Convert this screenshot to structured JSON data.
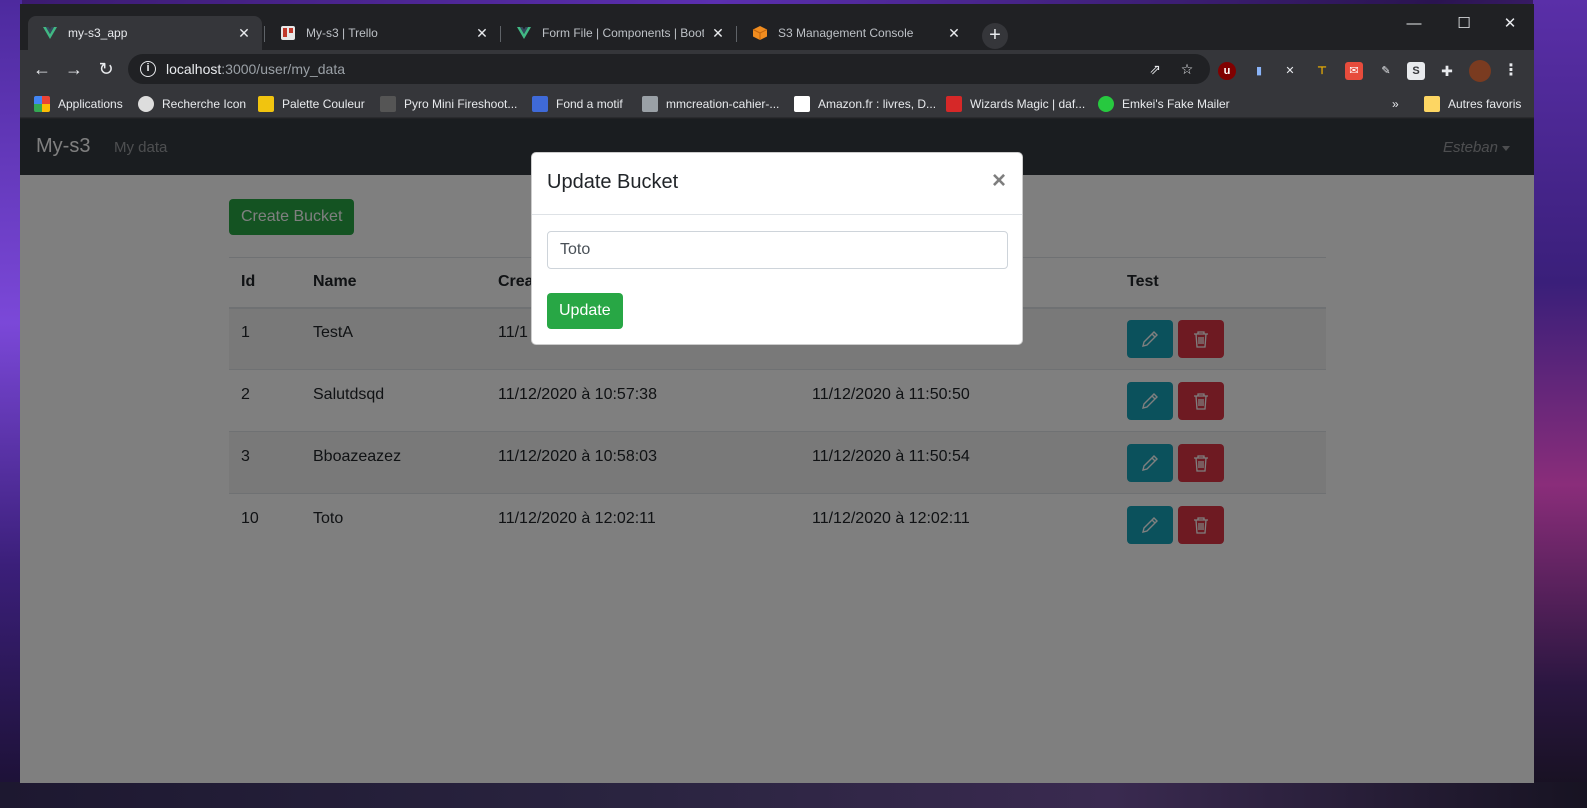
{
  "browser": {
    "tabs": [
      {
        "title": "my-s3_app",
        "icon_color": "#41b883",
        "active": true
      },
      {
        "title": "My-s3 | Trello",
        "icon_color": "#e8e8e8",
        "active": false
      },
      {
        "title": "Form File | Components | Bootstr",
        "icon_color": "#41b883",
        "active": false
      },
      {
        "title": "S3 Management Console",
        "icon_color": "#f08c1f",
        "active": false
      }
    ],
    "url_host": "localhost",
    "url_path": ":3000/user/my_data",
    "bookmarks": [
      {
        "label": "Applications",
        "color": "#ea4335"
      },
      {
        "label": "Recherche Icon",
        "color": "#dddddd"
      },
      {
        "label": "Palette Couleur",
        "color": "#f1c40f"
      },
      {
        "label": "Pyro Mini Fireshoot...",
        "color": "#555555"
      },
      {
        "label": "Fond a motif",
        "color": "#3f6ad8"
      },
      {
        "label": "mmcreation-cahier-...",
        "color": "#9aa0a6"
      },
      {
        "label": "Amazon.fr : livres, D...",
        "color": "#ffffff"
      },
      {
        "label": "Wizards Magic | daf...",
        "color": "#d62828"
      },
      {
        "label": "Emkei's Fake Mailer",
        "color": "#27c93f"
      }
    ],
    "other_bookmarks": "Autres favoris"
  },
  "navbar": {
    "brand": "My-s3",
    "link": "My data",
    "user": "Esteban"
  },
  "main": {
    "create_label": "Create Bucket",
    "columns": [
      "Id",
      "Name",
      "Crea",
      "",
      "Test"
    ],
    "rows": [
      {
        "id": "1",
        "name": "TestA",
        "created": "11/1",
        "updated": ""
      },
      {
        "id": "2",
        "name": "Salutdsqd",
        "created": "11/12/2020 à 10:57:38",
        "updated": "11/12/2020 à 11:50:50"
      },
      {
        "id": "3",
        "name": "Bboazeazez",
        "created": "11/12/2020 à 10:58:03",
        "updated": "11/12/2020 à 11:50:54"
      },
      {
        "id": "10",
        "name": "Toto",
        "created": "11/12/2020 à 12:02:11",
        "updated": "11/12/2020 à 12:02:11"
      }
    ]
  },
  "modal": {
    "title": "Update Bucket",
    "close": "×",
    "input_value": "Toto",
    "submit_label": "Update"
  },
  "colors": {
    "success": "#28a745",
    "info": "#17a2b8",
    "danger": "#dc3545",
    "navbar": "#343a40"
  }
}
